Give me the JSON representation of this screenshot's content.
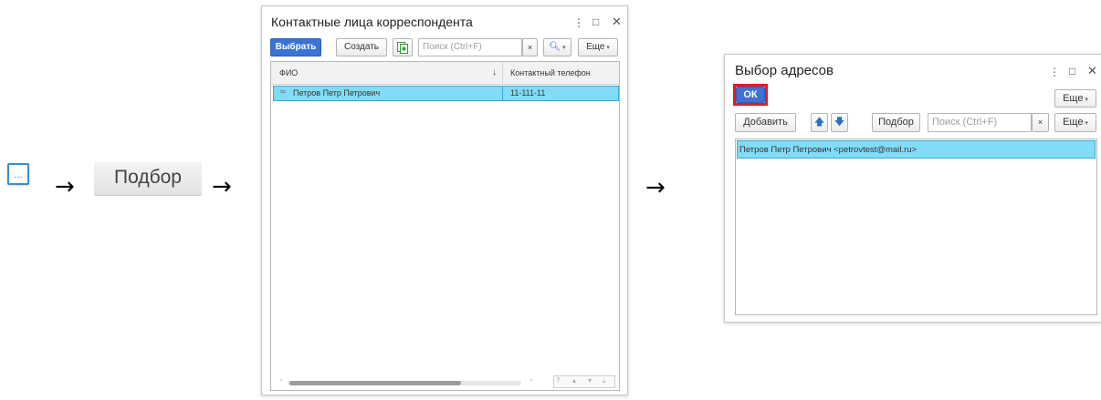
{
  "steps": {
    "dots_label": "...",
    "podbor_label": "Подбор",
    "arrow": "→"
  },
  "contacts_window": {
    "title": "Контактные лица корреспондента",
    "buttons": {
      "select": "Выбрать",
      "create": "Создать",
      "more": "Еще"
    },
    "search_placeholder": "Поиск (Ctrl+F)",
    "columns": {
      "name": "ФИО",
      "phone": "Контактный телефон",
      "sort_indicator": "↓"
    },
    "rows": [
      {
        "name": "Петров Петр Петрович",
        "phone": "11-111-11",
        "selected": true
      }
    ]
  },
  "address_window": {
    "title": "Выбор адресов",
    "buttons": {
      "ok": "ОК",
      "more": "Еще",
      "add": "Добавить",
      "podbor": "Подбор",
      "more2": "Еще"
    },
    "search_placeholder": "Поиск (Ctrl+F)",
    "rows": [
      {
        "text": "Петров Петр Петрович <petrovtest@mail.ru>",
        "selected": true
      }
    ]
  },
  "colors": {
    "accent": "#3a73d6",
    "selection": "#82dcf7",
    "highlight": "#e01b24"
  }
}
